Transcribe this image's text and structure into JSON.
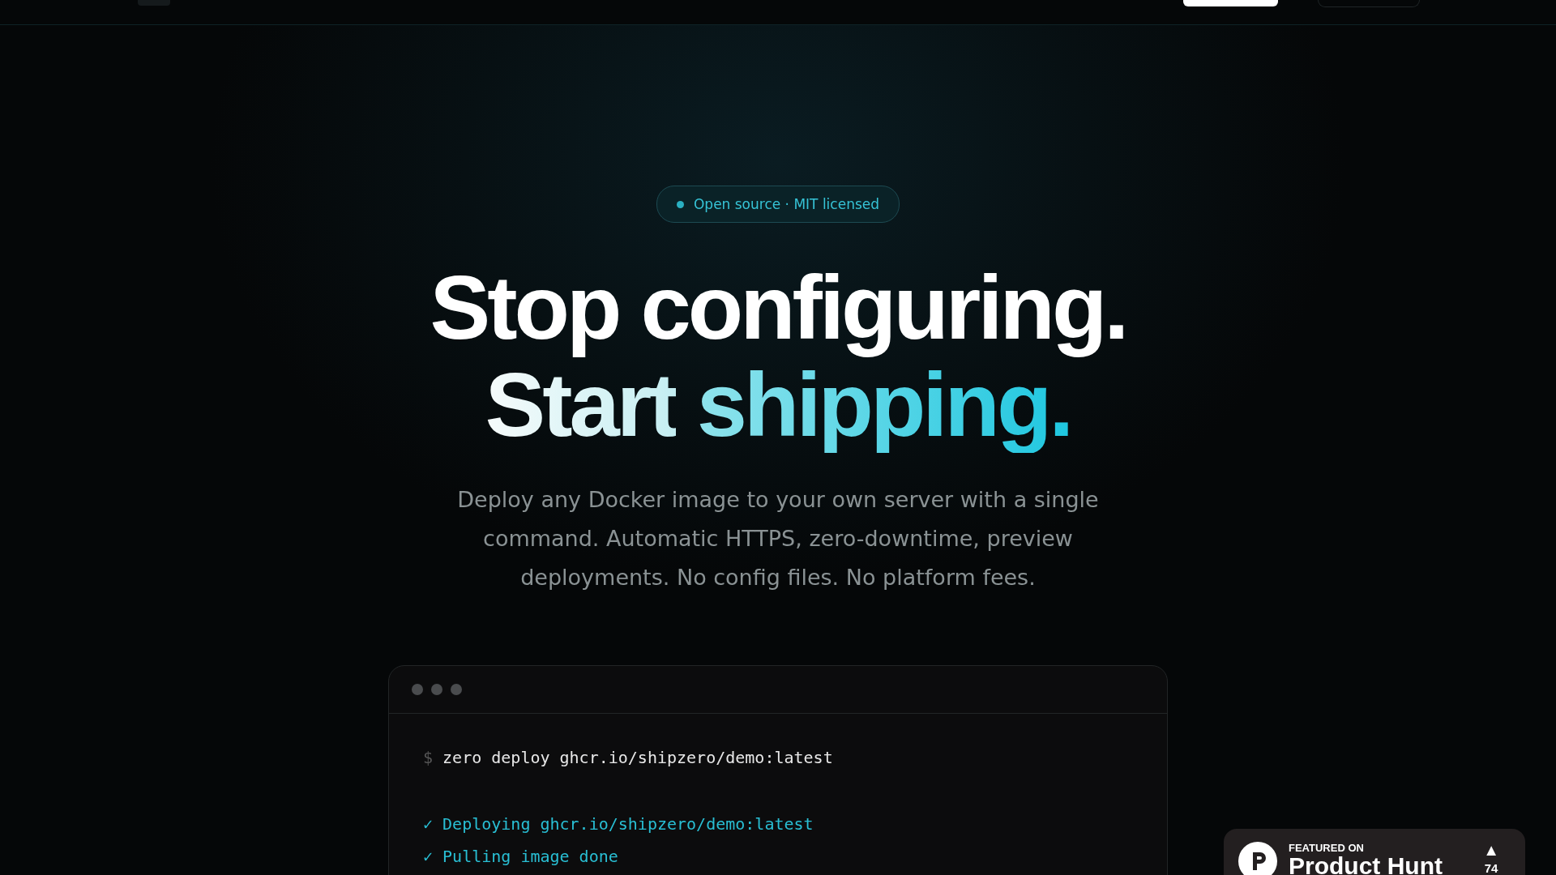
{
  "badge": {
    "text": "Open source · MIT licensed"
  },
  "headline": {
    "line_1": "Stop configuring.",
    "line_2_lead": "Start",
    "line_2_accent": "shipping."
  },
  "description": "Deploy any Docker image to your own server with a single command. Automatic HTTPS, zero-downtime, preview deployments. No config files. No platform fees.",
  "terminal": {
    "prompt": "$",
    "command": "zero deploy ghcr.io/shipzero/demo:latest",
    "output": [
      {
        "mark": "✓",
        "text": "Deploying ghcr.io/shipzero/demo:latest"
      },
      {
        "mark": "✓",
        "text": "Pulling image done"
      }
    ]
  },
  "product_hunt": {
    "eyebrow": "FEATURED ON",
    "name": "Product Hunt",
    "arrow": "▲",
    "votes": "74"
  }
}
